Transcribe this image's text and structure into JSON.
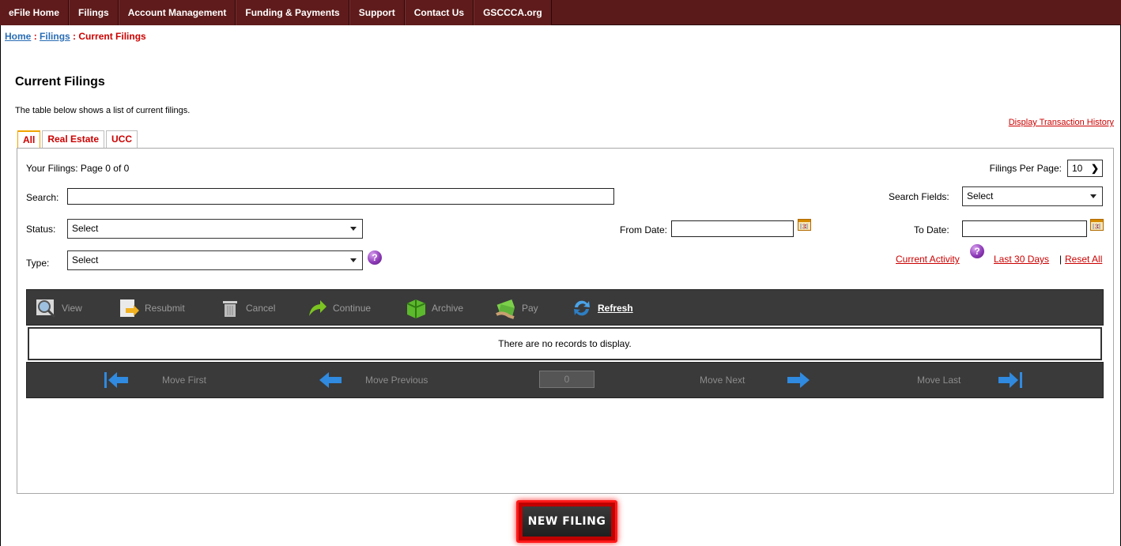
{
  "nav": {
    "items": [
      "eFile Home",
      "Filings",
      "Account Management",
      "Funding & Payments",
      "Support",
      "Contact Us",
      "GSCCCA.org"
    ]
  },
  "breadcrumb": {
    "home": "Home",
    "filings": "Filings",
    "current": "Current Filings",
    "sep": ":"
  },
  "page": {
    "title": "Current Filings",
    "intro": "The table below shows a list of current filings.",
    "transaction_history": "Display Transaction History"
  },
  "tabs": [
    "All",
    "Real Estate",
    "UCC"
  ],
  "panel": {
    "page_info": "Your Filings: Page 0 of 0",
    "per_page_label": "Filings Per Page:",
    "per_page_value": "10",
    "search_label": "Search:",
    "search_value": "",
    "search_fields_label": "Search Fields:",
    "search_fields_value": "Select",
    "status_label": "Status:",
    "status_value": "Select",
    "from_date_label": "From Date:",
    "from_date_value": "",
    "to_date_label": "To Date:",
    "to_date_value": "",
    "type_label": "Type:",
    "type_value": "Select",
    "current_activity": "Current Activity",
    "last_30_days": "Last 30 Days",
    "pipe": "|",
    "reset_all": "Reset All"
  },
  "toolbar": {
    "view": "View",
    "resubmit": "Resubmit",
    "cancel": "Cancel",
    "continue": "Continue",
    "archive": "Archive",
    "pay": "Pay",
    "refresh": "Refresh"
  },
  "grid": {
    "empty_message": "There are no records to display."
  },
  "pager": {
    "first": "Move First",
    "previous": "Move Previous",
    "page_value": "0",
    "next": "Move Next",
    "last": "Move Last"
  },
  "new_filing": "NEW FILING"
}
